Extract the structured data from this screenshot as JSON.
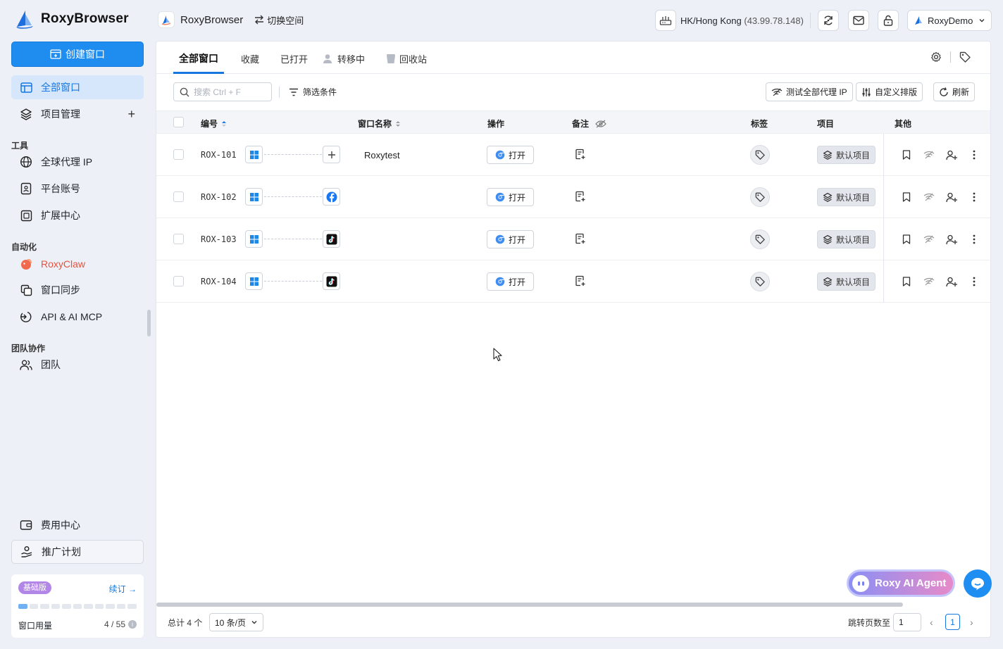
{
  "app": {
    "name": "RoxyBrowser"
  },
  "workspace": {
    "name": "RoxyBrowser",
    "switch_label": "切换空间"
  },
  "proxy": {
    "location": "HK/Hong Kong",
    "ip": "(43.99.78.148)"
  },
  "user": {
    "name": "RoxyDemo"
  },
  "sidebar": {
    "create_label": "创建窗口",
    "items": [
      {
        "label": "全部窗口"
      },
      {
        "label": "项目管理"
      }
    ],
    "sections": {
      "tools": "工具",
      "automation": "自动化",
      "team": "团队协作"
    },
    "tools": [
      {
        "label": "全球代理 IP"
      },
      {
        "label": "平台账号"
      },
      {
        "label": "扩展中心"
      }
    ],
    "automation": [
      {
        "label": "RoxyClaw"
      },
      {
        "label": "窗口同步"
      },
      {
        "label": "API & AI MCP"
      }
    ],
    "team": [
      {
        "label": "团队"
      }
    ],
    "bottom": [
      {
        "label": "费用中心"
      },
      {
        "label": "推广计划"
      }
    ],
    "plan": {
      "badge": "基础版",
      "renew": "续订 →",
      "usage_label": "窗口用量",
      "usage_value": "4 / 55",
      "used": 4,
      "limit": 55
    }
  },
  "tabs": [
    {
      "label": "全部窗口"
    },
    {
      "label": "收藏"
    },
    {
      "label": "已打开"
    },
    {
      "label": "转移中"
    },
    {
      "label": "回收站"
    }
  ],
  "toolbar": {
    "search_placeholder": "搜索 Ctrl + F",
    "filter_label": "筛选条件",
    "test_proxy_label": "测试全部代理 IP",
    "custom_sort_label": "自定义排版",
    "refresh_label": "刷新"
  },
  "table": {
    "headers": {
      "code": "编号",
      "name": "窗口名称",
      "action": "操作",
      "note": "备注",
      "tag": "标签",
      "project": "项目",
      "other": "其他"
    },
    "open_label": "打开",
    "rows": [
      {
        "code": "ROX-101",
        "os": "windows-icon",
        "platform": "add-icon",
        "name": "Roxytest",
        "project": "默认项目"
      },
      {
        "code": "ROX-102",
        "os": "windows-icon",
        "platform": "facebook-icon",
        "name": "",
        "project": "默认项目"
      },
      {
        "code": "ROX-103",
        "os": "windows-icon",
        "platform": "tiktok-icon",
        "name": "",
        "project": "默认项目"
      },
      {
        "code": "ROX-104",
        "os": "windows-icon",
        "platform": "tiktok-icon",
        "name": "",
        "project": "默认项目"
      }
    ]
  },
  "pagination": {
    "total": "总计 4 个",
    "page_size": "10 条/页",
    "jump_label": "跳转页数至",
    "jump_value": "1",
    "current_page": "1"
  },
  "agent": {
    "label": "Roxy AI Agent"
  },
  "colors": {
    "accent": "#1677e0",
    "primary_button": "#1f8cf0",
    "claw": "#e5533d",
    "plan_badge": "#b286e6"
  }
}
